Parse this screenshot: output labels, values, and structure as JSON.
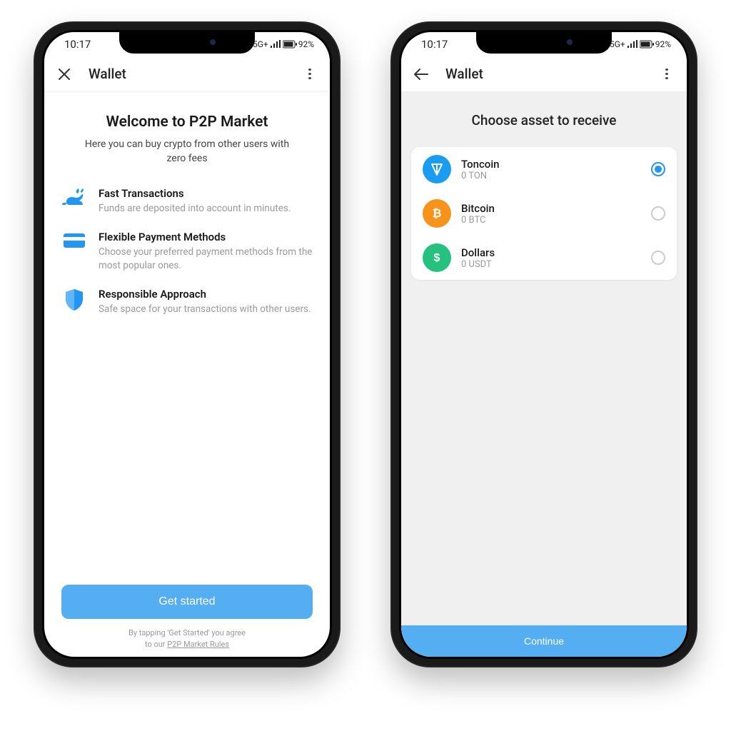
{
  "statusbar": {
    "time": "10:17",
    "network": "5G+",
    "battery_pct": "92%"
  },
  "screen1": {
    "header": {
      "title": "Wallet"
    },
    "welcome_title": "Welcome to P2P Market",
    "welcome_sub": "Here you can buy crypto from other users with zero fees",
    "features": [
      {
        "icon": "rabbit-icon",
        "title": "Fast Transactions",
        "desc": "Funds are deposited into account in minutes."
      },
      {
        "icon": "card-icon",
        "title": "Flexible Payment Methods",
        "desc": "Choose your preferred payment methods from the most popular ones."
      },
      {
        "icon": "shield-icon",
        "title": "Responsible Approach",
        "desc": "Safe space for your transactions with other users."
      }
    ],
    "cta": "Get started",
    "disclaimer_line1": "By tapping 'Get Started' you agree",
    "disclaimer_line2_prefix": "to our ",
    "disclaimer_link": "P2P Market Rules"
  },
  "screen2": {
    "header": {
      "title": "Wallet"
    },
    "choose_title": "Choose asset to receive",
    "assets": [
      {
        "name": "Toncoin",
        "balance": "0 TON",
        "color": "#1a9cf0",
        "symbol": "ton",
        "selected": true
      },
      {
        "name": "Bitcoin",
        "balance": "0 BTC",
        "color": "#f7931a",
        "symbol": "btc",
        "selected": false
      },
      {
        "name": "Dollars",
        "balance": "0 USDT",
        "color": "#26c07f",
        "symbol": "usd",
        "selected": false
      }
    ],
    "cta": "Continue"
  }
}
